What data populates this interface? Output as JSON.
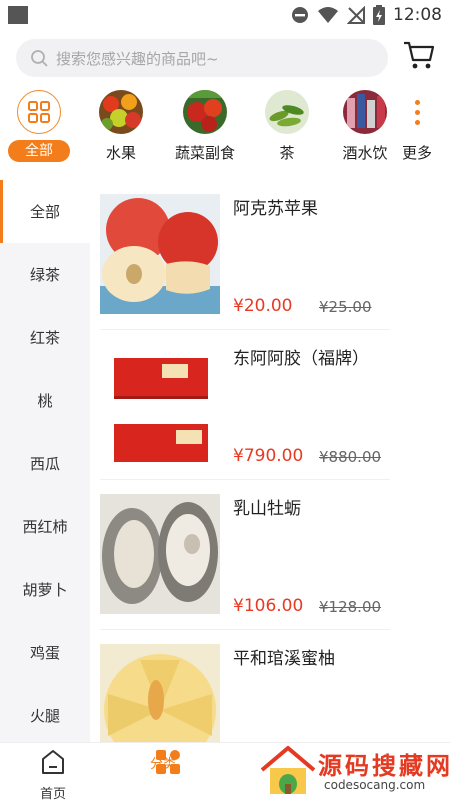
{
  "status_bar": {
    "time": "12:08"
  },
  "search": {
    "placeholder": "搜索您感兴趣的商品吧~"
  },
  "categories": [
    {
      "label": "全部",
      "icon": "grid-icon",
      "active": true
    },
    {
      "label": "水果",
      "icon": "fruit-image"
    },
    {
      "label": "蔬菜副食",
      "icon": "vegetables-image"
    },
    {
      "label": "茶",
      "icon": "tea-image"
    },
    {
      "label": "酒水饮",
      "icon": "drinks-image"
    },
    {
      "label": "更多",
      "icon": "more-dots-icon"
    }
  ],
  "sidebar": {
    "items": [
      {
        "label": "全部",
        "active": true
      },
      {
        "label": "绿茶"
      },
      {
        "label": "红茶"
      },
      {
        "label": "桃"
      },
      {
        "label": "西瓜"
      },
      {
        "label": "西红柿"
      },
      {
        "label": "胡萝卜"
      },
      {
        "label": "鸡蛋"
      },
      {
        "label": "火腿"
      }
    ]
  },
  "products": [
    {
      "name": "阿克苏苹果",
      "price": "¥20.00",
      "old_price": "¥25.00",
      "image": "apple-image"
    },
    {
      "name": "东阿阿胶（福牌）",
      "price": "¥790.00",
      "old_price": "¥880.00",
      "image": "ejiao-box-image"
    },
    {
      "name": "乳山牡蛎",
      "price": "¥106.00",
      "old_price": "¥128.00",
      "image": "oyster-image"
    },
    {
      "name": "平和琯溪蜜柚",
      "price": "",
      "old_price": "",
      "image": "pomelo-image"
    }
  ],
  "bottom_nav": {
    "home": "首页",
    "category": "分类"
  },
  "watermark": {
    "title": "源码搜藏网",
    "url": "codesocang.com"
  },
  "colors": {
    "accent": "#f27d1a",
    "price_red": "#e83a23"
  }
}
